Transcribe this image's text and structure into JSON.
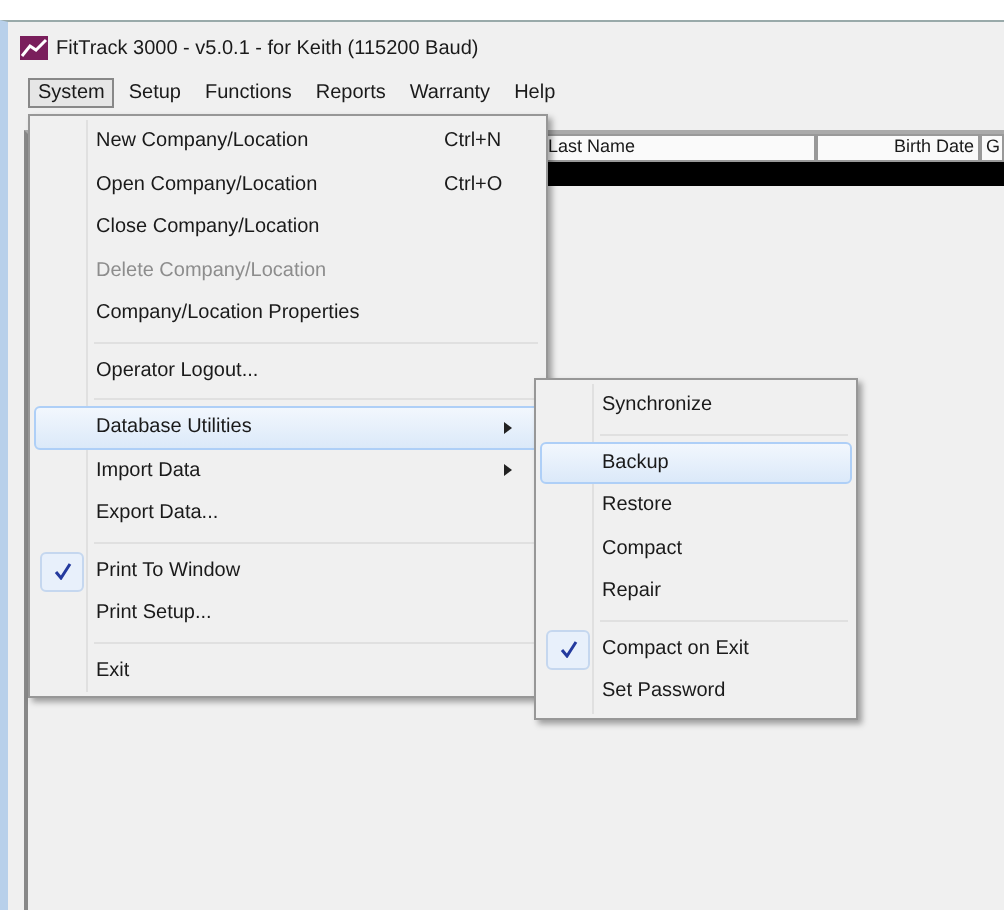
{
  "window": {
    "title": "FitTrack 3000 - v5.0.1 - for Keith (115200 Baud)"
  },
  "menubar": [
    {
      "label": "System",
      "selected": true
    },
    {
      "label": "Setup",
      "selected": false
    },
    {
      "label": "Functions",
      "selected": false
    },
    {
      "label": "Reports",
      "selected": false
    },
    {
      "label": "Warranty",
      "selected": false
    },
    {
      "label": "Help",
      "selected": false
    }
  ],
  "table": {
    "columns": [
      {
        "label": "Last Name"
      },
      {
        "label": "Birth Date"
      },
      {
        "label": "G"
      }
    ]
  },
  "system_menu": [
    {
      "kind": "item",
      "label": "New Company/Location",
      "shortcut": "Ctrl+N",
      "disabled": false,
      "selected": false,
      "checked": false,
      "submenu": false
    },
    {
      "kind": "item",
      "label": "Open Company/Location",
      "shortcut": "Ctrl+O",
      "disabled": false,
      "selected": false,
      "checked": false,
      "submenu": false
    },
    {
      "kind": "item",
      "label": "Close Company/Location",
      "disabled": false,
      "selected": false,
      "checked": false,
      "submenu": false
    },
    {
      "kind": "item",
      "label": "Delete Company/Location",
      "disabled": true,
      "selected": false,
      "checked": false,
      "submenu": false
    },
    {
      "kind": "item",
      "label": "Company/Location Properties",
      "disabled": false,
      "selected": false,
      "checked": false,
      "submenu": false
    },
    {
      "kind": "separator"
    },
    {
      "kind": "item",
      "label": "Operator Logout...",
      "disabled": false,
      "selected": false,
      "checked": false,
      "submenu": false
    },
    {
      "kind": "separator"
    },
    {
      "kind": "item",
      "label": "Database Utilities",
      "disabled": false,
      "selected": true,
      "checked": false,
      "submenu": true
    },
    {
      "kind": "item",
      "label": "Import Data",
      "disabled": false,
      "selected": false,
      "checked": false,
      "submenu": true
    },
    {
      "kind": "item",
      "label": "Export Data...",
      "disabled": false,
      "selected": false,
      "checked": false,
      "submenu": false
    },
    {
      "kind": "separator"
    },
    {
      "kind": "item",
      "label": "Print To Window",
      "disabled": false,
      "selected": false,
      "checked": true,
      "submenu": false
    },
    {
      "kind": "item",
      "label": "Print Setup...",
      "disabled": false,
      "selected": false,
      "checked": false,
      "submenu": false
    },
    {
      "kind": "separator"
    },
    {
      "kind": "item",
      "label": "Exit",
      "disabled": false,
      "selected": false,
      "checked": false,
      "submenu": false
    }
  ],
  "database_utilities_menu": [
    {
      "kind": "item",
      "label": "Synchronize",
      "disabled": false,
      "selected": false,
      "checked": false,
      "submenu": false
    },
    {
      "kind": "separator"
    },
    {
      "kind": "item",
      "label": "Backup",
      "disabled": false,
      "selected": true,
      "checked": false,
      "submenu": false
    },
    {
      "kind": "item",
      "label": "Restore",
      "disabled": false,
      "selected": false,
      "checked": false,
      "submenu": false
    },
    {
      "kind": "item",
      "label": "Compact",
      "disabled": false,
      "selected": false,
      "checked": false,
      "submenu": false
    },
    {
      "kind": "item",
      "label": "Repair",
      "disabled": false,
      "selected": false,
      "checked": false,
      "submenu": false
    },
    {
      "kind": "separator"
    },
    {
      "kind": "item",
      "label": "Compact on Exit",
      "disabled": false,
      "selected": false,
      "checked": true,
      "submenu": false
    },
    {
      "kind": "item",
      "label": "Set Password",
      "disabled": false,
      "selected": false,
      "checked": false,
      "submenu": false
    }
  ]
}
